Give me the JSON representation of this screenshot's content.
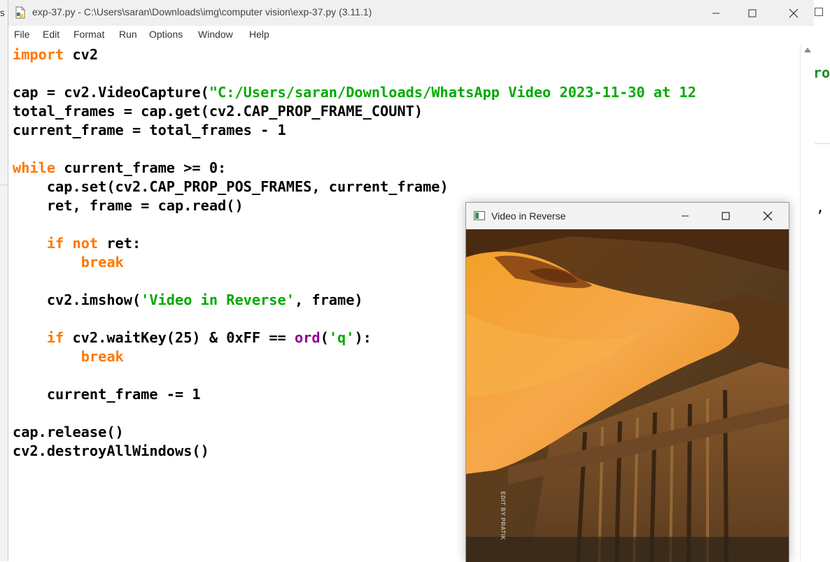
{
  "window": {
    "title": "exp-37.py - C:\\Users\\saran\\Downloads\\img\\computer vision\\exp-37.py (3.11.1)"
  },
  "menu": [
    "File",
    "Edit",
    "Format",
    "Run",
    "Options",
    "Window",
    "Help"
  ],
  "code": {
    "l1": {
      "a": "import",
      "b": " cv2"
    },
    "l3": {
      "a": "cap = cv2.VideoCapture(",
      "b": "\"C:/Users/saran/Downloads/WhatsApp Video 2023-11-30 at 12"
    },
    "l4": "total_frames = cap.get(cv2.CAP_PROP_FRAME_COUNT)",
    "l5": "current_frame = total_frames - 1",
    "l7": {
      "a": "while",
      "b": " current_frame >= 0:"
    },
    "l8": "    cap.set(cv2.CAP_PROP_POS_FRAMES, current_frame)",
    "l9": "    ret, frame = cap.read()",
    "l11": {
      "a": "    ",
      "b": "if",
      "c": " ",
      "d": "not",
      "e": " ret:"
    },
    "l12": {
      "a": "        ",
      "b": "break"
    },
    "l14": {
      "a": "    cv2.imshow(",
      "b": "'Video in Reverse'",
      "c": ", frame)"
    },
    "l16": {
      "a": "    ",
      "b": "if",
      "c": " cv2.waitKey(25) & 0xFF == ",
      "d": "ord",
      "e": "(",
      "f": "'q'",
      "g": "):"
    },
    "l17": {
      "a": "        ",
      "b": "break"
    },
    "l19": "    current_frame -= 1",
    "l21": "cap.release()",
    "l22": "cv2.destroyAllWindows()"
  },
  "video_window": {
    "title": "Video in Reverse",
    "watermark": "EDIT BY PRATIK"
  },
  "background": {
    "left_glyph": "s",
    "left_glyph2": "(",
    "right_text1": "ro",
    "right_text2": ","
  },
  "colors": {
    "keyword": "#ff7700",
    "string": "#00aa00",
    "builtin": "#900090"
  }
}
